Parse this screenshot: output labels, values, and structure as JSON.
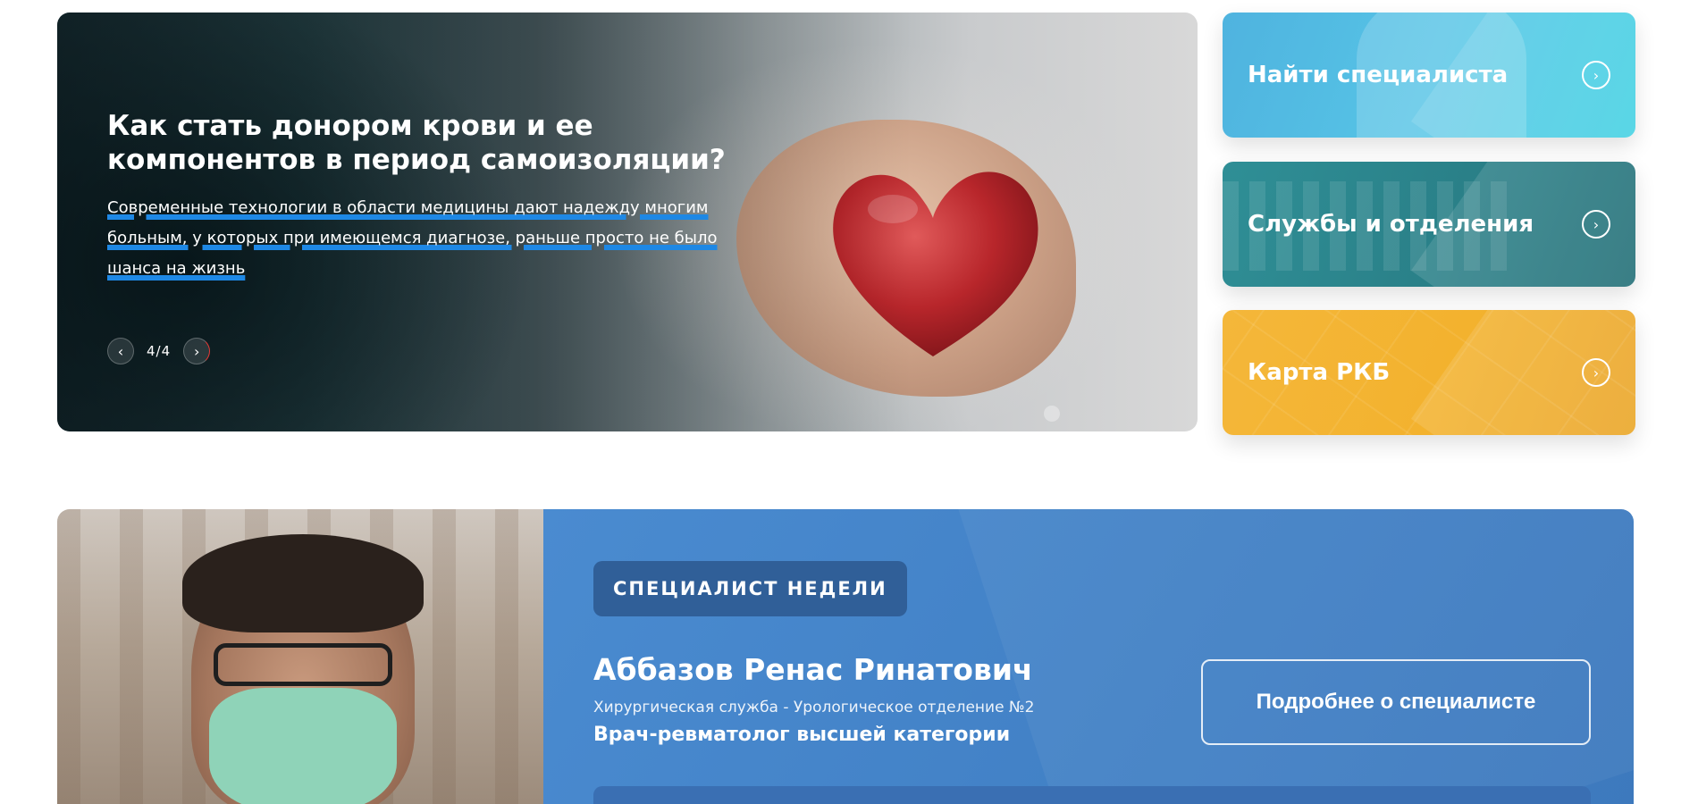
{
  "hero": {
    "title": "Как стать донором крови и ее компонентов в период самоизоляции?",
    "description": "Современные технологии в области медицины дают надежду многим больным, у которых при имеющемся диагнозе, раньше просто не было шанса на жизнь",
    "slide_counter": "4/4",
    "prev_icon": "chevron-left-icon",
    "next_icon": "chevron-right-icon"
  },
  "quick_links": [
    {
      "label": "Найти специалиста",
      "icon": "chevron-right-circle-icon",
      "color": "#4fb3df"
    },
    {
      "label": "Службы и отделения",
      "icon": "chevron-right-circle-icon",
      "color": "#2a8088"
    },
    {
      "label": "Карта РКБ",
      "icon": "chevron-right-circle-icon",
      "color": "#f3b22e"
    }
  ],
  "specialist": {
    "badge": "СПЕЦИАЛИСТ НЕДЕЛИ",
    "name": "Аббазов Ренас Ринатович",
    "department": "Хирургическая служба - Урологическое отделение №2",
    "role": "Врач-ревматолог высшей категории",
    "more_button": "Подробнее о специалисте",
    "panel_color": "#4281c6"
  }
}
